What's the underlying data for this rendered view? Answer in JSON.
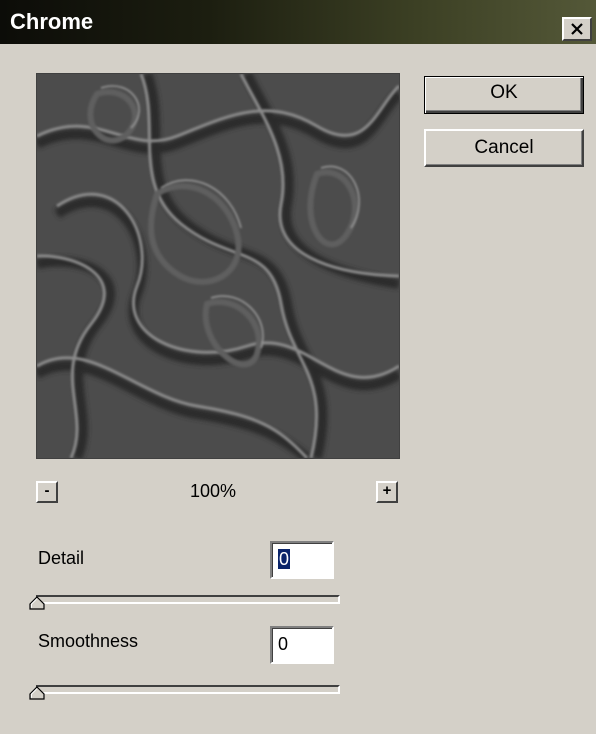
{
  "window": {
    "title": "Chrome"
  },
  "buttons": {
    "ok_label": "OK",
    "cancel_label": "Cancel"
  },
  "zoom": {
    "minus_label": "-",
    "plus_label": "+",
    "level": "100%"
  },
  "controls": {
    "detail": {
      "label": "Detail",
      "value": "0",
      "slider_fraction": 0
    },
    "smoothness": {
      "label": "Smoothness",
      "value": "0",
      "slider_fraction": 0
    }
  },
  "colors": {
    "dialog_bg": "#d4d0c8",
    "selection": "#0a246a",
    "preview_bg": "#4a4a4a"
  },
  "icons": {
    "close": "close-icon",
    "slider_thumb": "slider-thumb-icon"
  }
}
